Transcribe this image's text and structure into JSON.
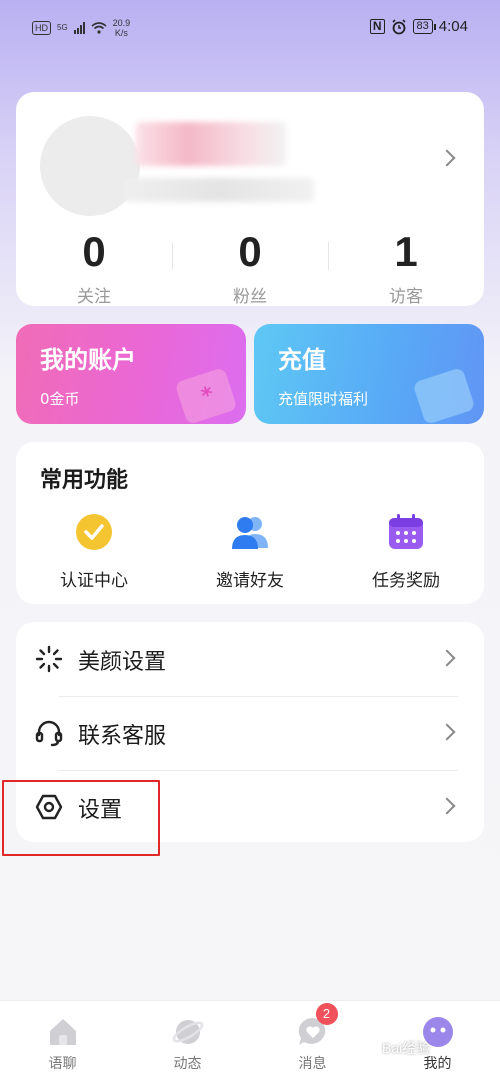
{
  "status_bar": {
    "left_badge": "HD",
    "network": "5G",
    "speed_value": "20.9",
    "speed_unit": "K/s",
    "nfc": "N",
    "battery": "83",
    "time": "4:04"
  },
  "profile": {
    "stats": [
      {
        "value": "0",
        "label": "关注"
      },
      {
        "value": "0",
        "label": "粉丝"
      },
      {
        "value": "1",
        "label": "访客"
      }
    ]
  },
  "promo": {
    "account": {
      "title": "我的账户",
      "subtitle": "0金币"
    },
    "recharge": {
      "title": "充值",
      "subtitle": "充值限时福利"
    }
  },
  "functions": {
    "title": "常用功能",
    "items": [
      {
        "label": "认证中心",
        "icon": "verified-check-icon"
      },
      {
        "label": "邀请好友",
        "icon": "invite-friends-icon"
      },
      {
        "label": "任务奖励",
        "icon": "calendar-task-icon"
      }
    ]
  },
  "menu": [
    {
      "label": "美颜设置",
      "icon": "sparkle-icon"
    },
    {
      "label": "联系客服",
      "icon": "headset-icon"
    },
    {
      "label": "设置",
      "icon": "hexagon-settings-icon"
    }
  ],
  "tabs": [
    {
      "label": "语聊",
      "icon": "home-icon"
    },
    {
      "label": "动态",
      "icon": "planet-icon"
    },
    {
      "label": "消息",
      "icon": "message-heart-icon",
      "badge": "2"
    },
    {
      "label": "我的",
      "icon": "me-icon"
    }
  ],
  "watermark": "Bai经验",
  "colors": {
    "accent_purple": "#b9b0f2",
    "account_pink": "#ea67d6",
    "recharge_blue": "#58a9f6",
    "highlight_red": "#e02828",
    "badge_red": "#f0515a"
  }
}
